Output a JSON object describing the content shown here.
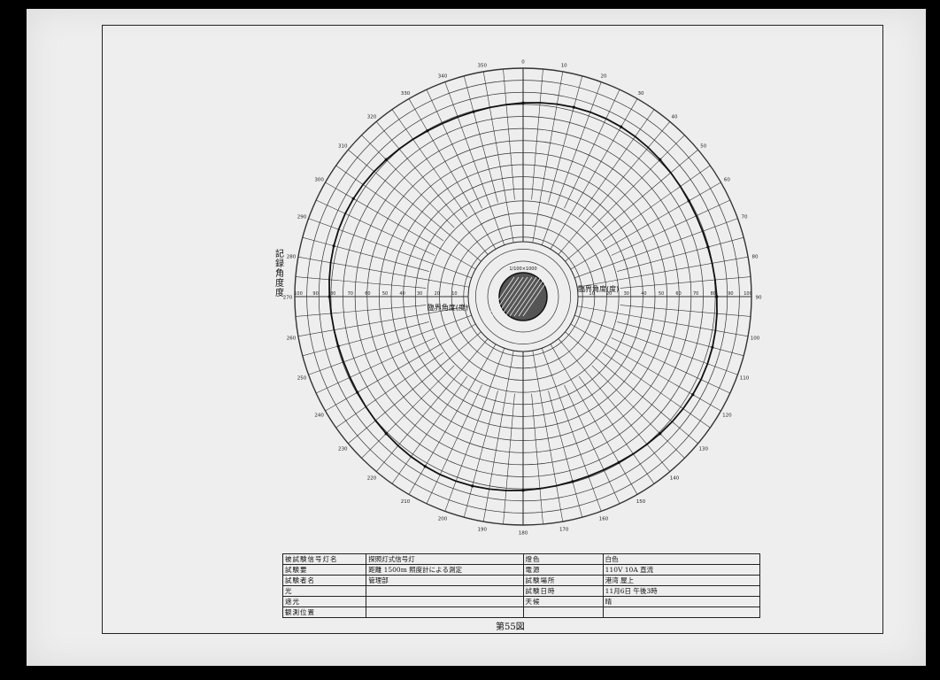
{
  "chart_data": {
    "type": "polar",
    "angle_labels": [
      "0",
      "10",
      "20",
      "30",
      "40",
      "50",
      "60",
      "70",
      "80",
      "90",
      "100",
      "110",
      "120",
      "130",
      "140",
      "150",
      "160",
      "170",
      "180",
      "190",
      "200",
      "210",
      "220",
      "230",
      "240",
      "250",
      "260",
      "270",
      "280",
      "290",
      "300",
      "310",
      "320",
      "330",
      "340",
      "350"
    ],
    "radial_tick_labels_right": [
      "10",
      "20",
      "30",
      "40",
      "50",
      "60",
      "70",
      "80",
      "90",
      "100"
    ],
    "radial_tick_labels_left": [
      "10",
      "20",
      "30",
      "40",
      "50",
      "60",
      "70",
      "80",
      "90",
      "100"
    ],
    "center_label": "1/100×1000",
    "annotation_right": "臨界角度(度)",
    "annotation_left": "臨界角度(度)",
    "vertical_label": "記録角度度",
    "series": [
      {
        "values_approx": "near-constant ring",
        "r_approx": 80
      }
    ]
  },
  "table": {
    "rows": [
      {
        "k1": "被試験信号灯名",
        "v1": "探照灯式信号灯",
        "k2": "燈色",
        "v2": "白色"
      },
      {
        "k1": "試験要",
        "v1": "距離 1500m 照度計による測定",
        "k2": "電源",
        "v2": "110V 10A 直流"
      },
      {
        "k1": "試験者名",
        "v1": "管理部",
        "k2": "試験場所",
        "v2": "港湾 屋上"
      },
      {
        "k1": "光",
        "v1": "",
        "k2": "試験日時",
        "v2": "11月6日 午後3時"
      },
      {
        "k1": "遮光",
        "v1": "",
        "k2": "天候",
        "v2": "晴"
      },
      {
        "k1": "観測位置",
        "v1": "",
        "k2": "",
        "v2": ""
      }
    ]
  },
  "caption": "第55図"
}
